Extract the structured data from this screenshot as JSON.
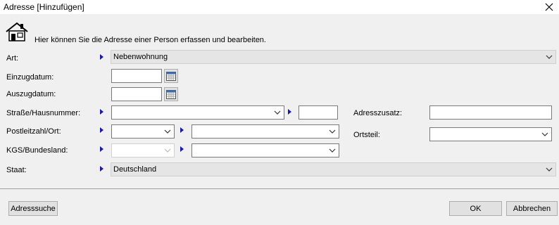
{
  "window": {
    "title": "Adresse [Hinzufügen]"
  },
  "intro": "Hier können Sie die Adresse einer Person erfassen und bearbeiten.",
  "labels": {
    "art": "Art:",
    "einzug": "Einzugdatum:",
    "auszug": "Auszugdatum:",
    "strasse": "Straße/Hausnummer:",
    "plz": "Postleitzahl/Ort:",
    "kgs": "KGS/Bundesland:",
    "staat": "Staat:",
    "adresszusatz": "Adresszusatz:",
    "ortsteil": "Ortsteil:"
  },
  "values": {
    "art": "Nebenwohnung",
    "einzug": "",
    "auszug": "",
    "strasse": "",
    "hausnummer": "",
    "plz": "",
    "ort": "",
    "kgs": "",
    "bundesland": "",
    "staat": "Deutschland",
    "adresszusatz": "",
    "ortsteil": ""
  },
  "buttons": {
    "adresssuche": "Adresssuche",
    "ok": "OK",
    "abbrechen": "Abbrechen"
  },
  "colors": {
    "arrow": "#1a1aa8",
    "dialog_bg": "#f0f0f0"
  },
  "icons": [
    "house-icon",
    "close-icon",
    "calendar-icon",
    "chevron-down-icon",
    "blue-arrow-icon"
  ]
}
